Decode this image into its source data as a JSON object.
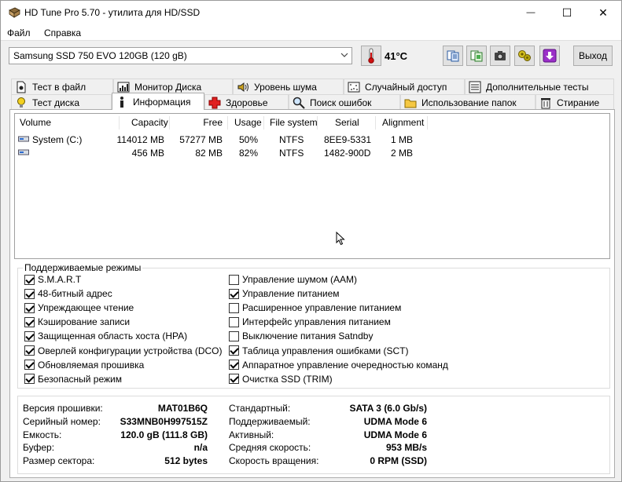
{
  "window": {
    "title": "HD Tune Pro 5.70 - утилита для HD/SSD",
    "minimize": "—",
    "maximize": "☐",
    "close": "✕"
  },
  "menu": [
    {
      "label": "Файл"
    },
    {
      "label": "Справка"
    }
  ],
  "toolbar": {
    "drive": "Samsung SSD 750 EVO 120GB (120 gB)",
    "temperature": "41°C",
    "exit_label": "Выход",
    "icons": [
      "copy-text-icon",
      "copy-info-icon",
      "camera-icon",
      "options-icon",
      "download-icon"
    ]
  },
  "tabs_row1": [
    {
      "label": "Тест в файл",
      "icon": "file-test-icon"
    },
    {
      "label": "Монитор Диска",
      "icon": "disk-monitor-icon"
    },
    {
      "label": "Уровень шума",
      "icon": "speaker-icon"
    },
    {
      "label": "Случайный доступ",
      "icon": "random-access-icon"
    },
    {
      "label": "Дополнительные тесты",
      "icon": "extra-tests-icon"
    }
  ],
  "tabs_row2": [
    {
      "label": "Тест диска",
      "icon": "benchmark-icon"
    },
    {
      "label": "Информация",
      "icon": "info-icon",
      "active": true
    },
    {
      "label": "Здоровье",
      "icon": "health-cross-icon"
    },
    {
      "label": "Поиск ошибок",
      "icon": "error-scan-icon"
    },
    {
      "label": "Использование папок",
      "icon": "folder-icon"
    },
    {
      "label": "Стирание",
      "icon": "erase-icon"
    }
  ],
  "volumes": {
    "columns": [
      "Volume",
      "Capacity",
      "Free",
      "Usage",
      "File system",
      "Serial",
      "Alignment"
    ],
    "rows": [
      [
        "System (C:)",
        "114012 MB",
        "57277 MB",
        "50%",
        "NTFS",
        "8EE9-5331",
        "1 MB"
      ],
      [
        "",
        "456 MB",
        "82 MB",
        "82%",
        "NTFS",
        "1482-900D",
        "2 MB"
      ]
    ]
  },
  "features": {
    "title": "Поддерживаемые режимы",
    "left": [
      {
        "label": "S.M.A.R.T",
        "checked": true
      },
      {
        "label": "48-битный адрес",
        "checked": true
      },
      {
        "label": "Упреждающее чтение",
        "checked": true
      },
      {
        "label": "Кэширование записи",
        "checked": true
      },
      {
        "label": "Защищенная область хоста (HPA)",
        "checked": true
      },
      {
        "label": "Оверлей конфигурации устройства (DCO)",
        "checked": true
      },
      {
        "label": "Обновляемая прошивка",
        "checked": true
      },
      {
        "label": "Безопасный режим",
        "checked": true
      }
    ],
    "right": [
      {
        "label": "Управление шумом (AAM)",
        "checked": false
      },
      {
        "label": "Управление питанием",
        "checked": true
      },
      {
        "label": "Расширенное управление питанием",
        "checked": false
      },
      {
        "label": "Интерфейс управления питанием",
        "checked": false
      },
      {
        "label": "Выключение питания Satndby",
        "checked": false
      },
      {
        "label": "Таблица управления ошибками (SCT)",
        "checked": true
      },
      {
        "label": "Аппаратное управление очередностью команд",
        "checked": true
      },
      {
        "label": "Очистка SSD (TRIM)",
        "checked": true
      }
    ]
  },
  "info": {
    "left": [
      {
        "label": "Версия прошивки:",
        "value": "MAT01B6Q"
      },
      {
        "label": "Серийный номер:",
        "value": "S33MNB0H997515Z"
      },
      {
        "label": "Емкость:",
        "value": "120.0 gB (111.8 GB)"
      },
      {
        "label": "Буфер:",
        "value": "n/a"
      },
      {
        "label": "Размер сектора:",
        "value": "512 bytes"
      }
    ],
    "right": [
      {
        "label": "Стандартный:",
        "value": "SATA 3 (6.0 Gb/s)"
      },
      {
        "label": "Поддерживаемый:",
        "value": "UDMA Mode 6"
      },
      {
        "label": "Активный:",
        "value": "UDMA Mode 6"
      },
      {
        "label": "Средняя скорость:",
        "value": "953 MB/s"
      },
      {
        "label": "Скорость вращения:",
        "value": "0 RPM (SSD)"
      }
    ]
  }
}
